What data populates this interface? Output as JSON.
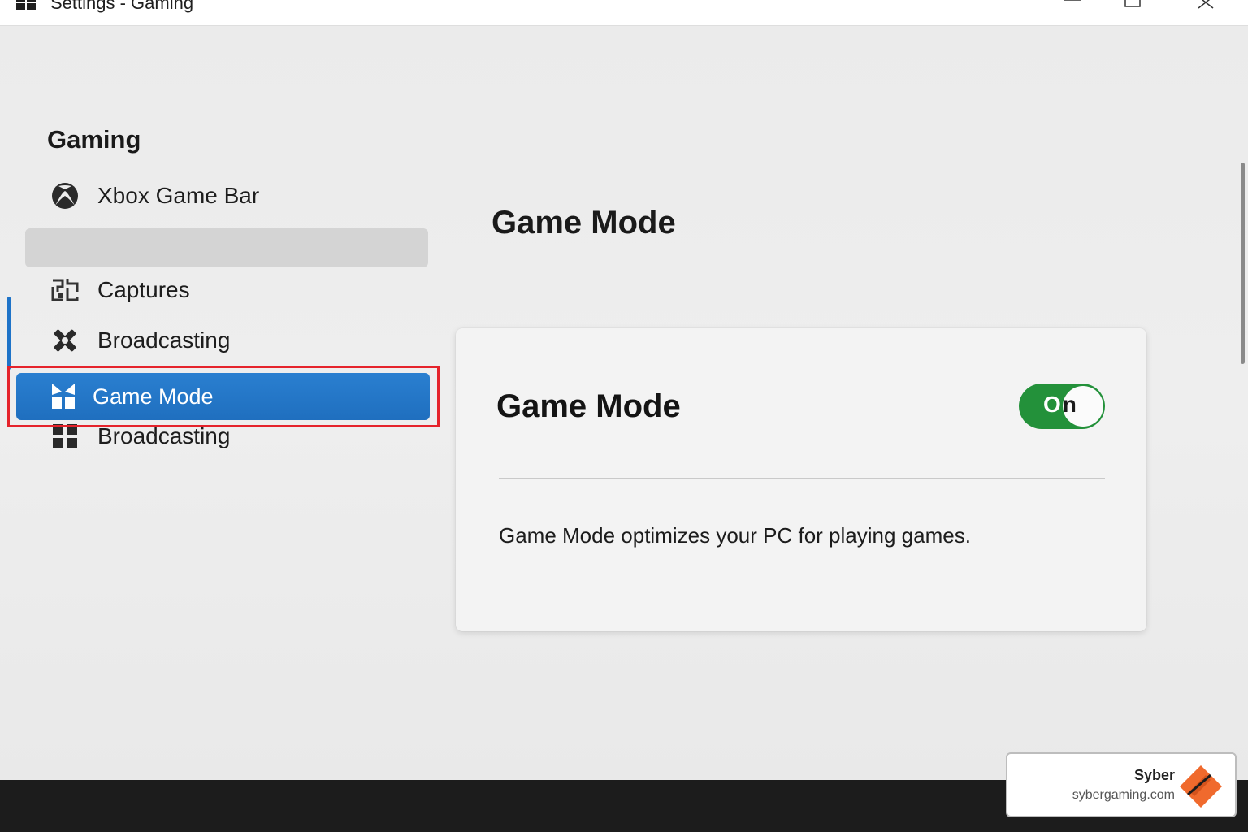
{
  "window": {
    "title": "Settings - Gaming"
  },
  "sidebar": {
    "section_title": "Gaming",
    "items": [
      {
        "label": "Xbox Game Bar",
        "icon": "xbox-icon"
      },
      {
        "label": "Captures",
        "icon": "captures-icon"
      },
      {
        "label": "Broadcasting",
        "icon": "broadcasting-icon"
      },
      {
        "label": "Game Mode",
        "icon": "game-mode-icon",
        "selected": true
      },
      {
        "label": "Broadcasting",
        "icon": "grid-icon"
      }
    ]
  },
  "main": {
    "heading": "Game Mode",
    "card": {
      "title": "Game Mode",
      "toggle": {
        "label_o": "O",
        "label_n": "n",
        "state": "on"
      },
      "description": "Game Mode optimizes your PC for playing games."
    }
  },
  "badge": {
    "name": "Syber",
    "url": "sybergaming.com"
  },
  "colors": {
    "accent": "#1f6fbf",
    "toggle_on": "#23913a",
    "highlight": "#e5232b",
    "logo": "#f06a2d"
  }
}
